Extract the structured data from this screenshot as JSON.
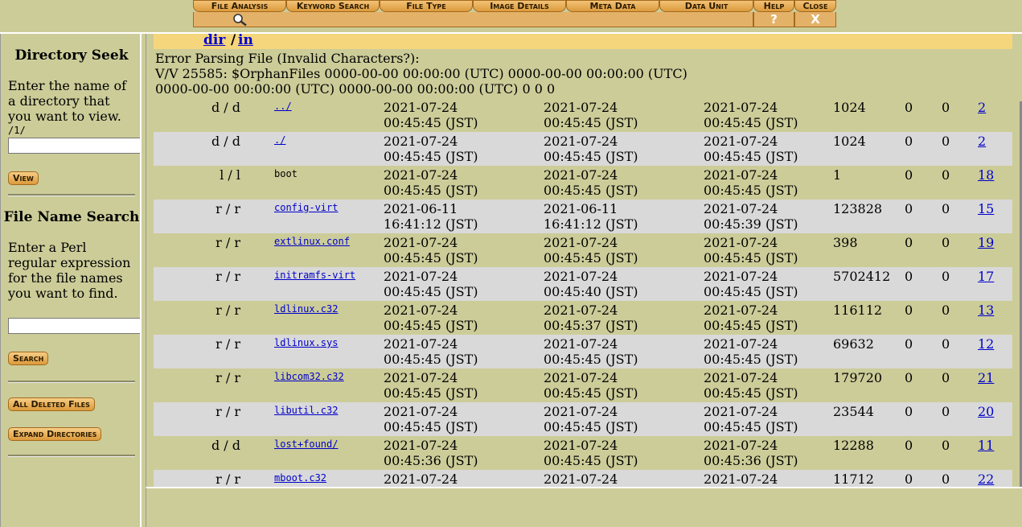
{
  "tabs": {
    "file_analysis": "File Analysis",
    "keyword_search": "Keyword Search",
    "file_type": "File Type",
    "image_details": "Image Details",
    "meta_data": "Meta Data",
    "data_unit": "Data Unit",
    "help": "Help",
    "close": "Close",
    "help_glyph": "?",
    "close_glyph": "X"
  },
  "left_panel": {
    "directory_seek": {
      "title": "Directory Seek",
      "description": "Enter the name of a directory that you want to view.",
      "current_path": "/1/",
      "input_value": "",
      "button": "View"
    },
    "file_name_search": {
      "title": "File Name Search",
      "description": "Enter a Perl regular expression for the file names you want to find.",
      "input_value": "",
      "button": "Search"
    },
    "all_deleted_button": "All Deleted Files",
    "expand_button": "Expand Directories"
  },
  "path": {
    "part1": "dir",
    "sep": "/",
    "part2": "in"
  },
  "error": {
    "line1": "Error Parsing File (Invalid Characters?):",
    "line2": "V/V 25585: $OrphanFiles 0000-00-00 00:00:00 (UTC) 0000-00-00 00:00:00 (UTC)",
    "line3": "0000-00-00 00:00:00 (UTC) 0000-00-00 00:00:00 (UTC) 0 0 0"
  },
  "files": [
    {
      "type": "d / d",
      "name": "../",
      "link": true,
      "d1a": "2021-07-24",
      "d1b": "00:45:45 (JST)",
      "d2a": "2021-07-24",
      "d2b": "00:45:45 (JST)",
      "d3a": "2021-07-24",
      "d3b": "00:45:45 (JST)",
      "size": "1024",
      "uid": "0",
      "gid": "0",
      "meta": "2"
    },
    {
      "type": "d / d",
      "name": "./",
      "link": true,
      "d1a": "2021-07-24",
      "d1b": "00:45:45 (JST)",
      "d2a": "2021-07-24",
      "d2b": "00:45:45 (JST)",
      "d3a": "2021-07-24",
      "d3b": "00:45:45 (JST)",
      "size": "1024",
      "uid": "0",
      "gid": "0",
      "meta": "2"
    },
    {
      "type": "l / l",
      "name": "boot",
      "link": false,
      "d1a": "2021-07-24",
      "d1b": "00:45:45 (JST)",
      "d2a": "2021-07-24",
      "d2b": "00:45:45 (JST)",
      "d3a": "2021-07-24",
      "d3b": "00:45:45 (JST)",
      "size": "1",
      "uid": "0",
      "gid": "0",
      "meta": "18"
    },
    {
      "type": "r / r",
      "name": "config-virt",
      "link": true,
      "d1a": "2021-06-11",
      "d1b": "16:41:12 (JST)",
      "d2a": "2021-06-11",
      "d2b": "16:41:12 (JST)",
      "d3a": "2021-07-24",
      "d3b": "00:45:39 (JST)",
      "size": "123828",
      "uid": "0",
      "gid": "0",
      "meta": "15"
    },
    {
      "type": "r / r",
      "name": "extlinux.conf",
      "link": true,
      "d1a": "2021-07-24",
      "d1b": "00:45:45 (JST)",
      "d2a": "2021-07-24",
      "d2b": "00:45:45 (JST)",
      "d3a": "2021-07-24",
      "d3b": "00:45:45 (JST)",
      "size": "398",
      "uid": "0",
      "gid": "0",
      "meta": "19"
    },
    {
      "type": "r / r",
      "name": "initramfs-virt",
      "link": true,
      "d1a": "2021-07-24",
      "d1b": "00:45:45 (JST)",
      "d2a": "2021-07-24",
      "d2b": "00:45:40 (JST)",
      "d3a": "2021-07-24",
      "d3b": "00:45:45 (JST)",
      "size": "5702412",
      "uid": "0",
      "gid": "0",
      "meta": "17"
    },
    {
      "type": "r / r",
      "name": "ldlinux.c32",
      "link": true,
      "d1a": "2021-07-24",
      "d1b": "00:45:45 (JST)",
      "d2a": "2021-07-24",
      "d2b": "00:45:37 (JST)",
      "d3a": "2021-07-24",
      "d3b": "00:45:45 (JST)",
      "size": "116112",
      "uid": "0",
      "gid": "0",
      "meta": "13"
    },
    {
      "type": "r / r",
      "name": "ldlinux.sys",
      "link": true,
      "d1a": "2021-07-24",
      "d1b": "00:45:45 (JST)",
      "d2a": "2021-07-24",
      "d2b": "00:45:45 (JST)",
      "d3a": "2021-07-24",
      "d3b": "00:45:45 (JST)",
      "size": "69632",
      "uid": "0",
      "gid": "0",
      "meta": "12"
    },
    {
      "type": "r / r",
      "name": "libcom32.c32",
      "link": true,
      "d1a": "2021-07-24",
      "d1b": "00:45:45 (JST)",
      "d2a": "2021-07-24",
      "d2b": "00:45:45 (JST)",
      "d3a": "2021-07-24",
      "d3b": "00:45:45 (JST)",
      "size": "179720",
      "uid": "0",
      "gid": "0",
      "meta": "21"
    },
    {
      "type": "r / r",
      "name": "libutil.c32",
      "link": true,
      "d1a": "2021-07-24",
      "d1b": "00:45:45 (JST)",
      "d2a": "2021-07-24",
      "d2b": "00:45:45 (JST)",
      "d3a": "2021-07-24",
      "d3b": "00:45:45 (JST)",
      "size": "23544",
      "uid": "0",
      "gid": "0",
      "meta": "20"
    },
    {
      "type": "d / d",
      "name": "lost+found/",
      "link": true,
      "d1a": "2021-07-24",
      "d1b": "00:45:36 (JST)",
      "d2a": "2021-07-24",
      "d2b": "00:45:45 (JST)",
      "d3a": "2021-07-24",
      "d3b": "00:45:36 (JST)",
      "size": "12288",
      "uid": "0",
      "gid": "0",
      "meta": "11"
    },
    {
      "type": "r / r",
      "name": "mboot.c32",
      "link": true,
      "d1a": "2021-07-24",
      "d1b": "",
      "d2a": "2021-07-24",
      "d2b": "",
      "d3a": "2021-07-24",
      "d3b": "",
      "size": "11712",
      "uid": "0",
      "gid": "0",
      "meta": "22"
    }
  ]
}
